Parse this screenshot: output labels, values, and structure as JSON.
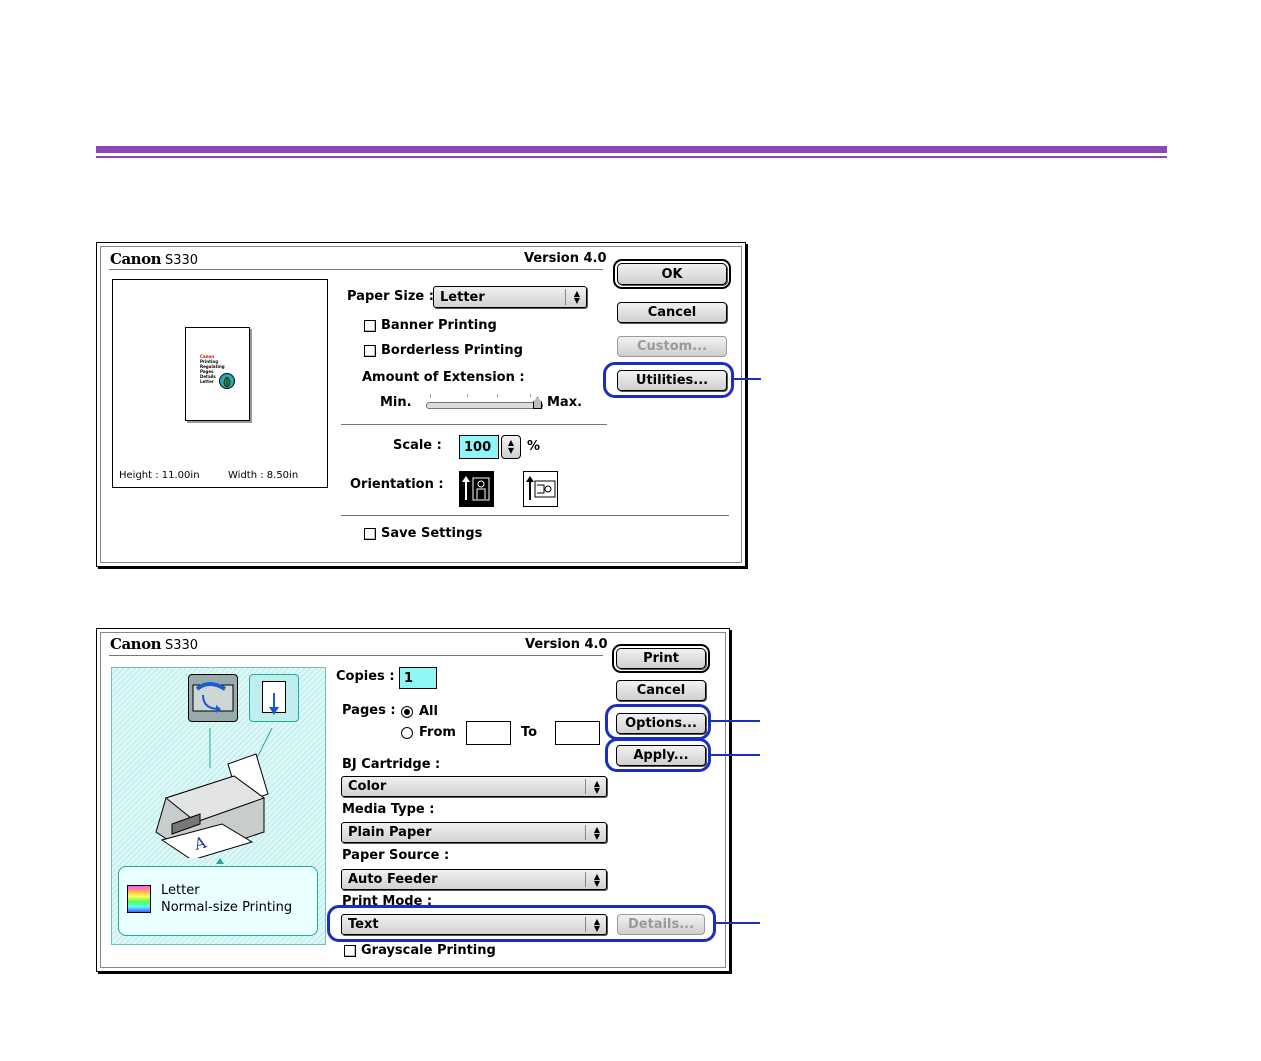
{
  "dialog1": {
    "brand": "Canon",
    "model": "S330",
    "version": "Version 4.0",
    "preview": {
      "height_label": "Height : 11.00in",
      "width_label": "Width : 8.50in",
      "thumb_lines": [
        "Canon",
        "Printing",
        "Regulating",
        "Pages",
        "Details",
        "Letter"
      ]
    },
    "paper_size_label": "Paper Size :",
    "paper_size_value": "Letter",
    "banner_printing": "Banner Printing",
    "borderless_printing": "Borderless Printing",
    "amount_of_extension": "Amount of Extension :",
    "slider_min": "Min.",
    "slider_max": "Max.",
    "scale_label": "Scale :",
    "scale_value": "100",
    "scale_unit": "%",
    "orientation_label": "Orientation :",
    "save_settings": "Save Settings",
    "buttons": {
      "ok": "OK",
      "cancel": "Cancel",
      "custom": "Custom...",
      "utilities": "Utilities..."
    }
  },
  "dialog2": {
    "brand": "Canon",
    "model": "S330",
    "version": "Version 4.0",
    "copies_label": "Copies :",
    "copies_value": "1",
    "pages_label": "Pages :",
    "pages_all": "All",
    "pages_from": "From",
    "pages_to": "To",
    "bj_cartridge_label": "BJ Cartridge :",
    "bj_cartridge_value": "Color",
    "media_type_label": "Media Type :",
    "media_type_value": "Plain Paper",
    "paper_source_label": "Paper Source :",
    "paper_source_value": "Auto Feeder",
    "print_mode_label": "Print Mode :",
    "print_mode_value": "Text",
    "details_button": "Details...",
    "grayscale_printing": "Grayscale Printing",
    "info_paper": "Letter",
    "info_mode": "Normal-size Printing",
    "buttons": {
      "print": "Print",
      "cancel": "Cancel",
      "options": "Options...",
      "apply": "Apply..."
    }
  },
  "colors": {
    "accent_rule": "#8a45b6",
    "callout": "#1a2fbf",
    "field_highlight": "#8ff5f5"
  }
}
